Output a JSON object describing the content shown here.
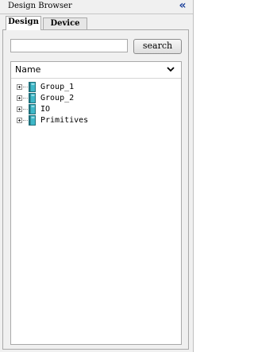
{
  "window": {
    "title": "Design Browser",
    "collapse_icon": "double-chevron-left-icon"
  },
  "tabs": [
    {
      "label": "Design",
      "active": true
    },
    {
      "label": "Device",
      "active": false
    }
  ],
  "search": {
    "value": "",
    "placeholder": "",
    "button_label": "search"
  },
  "tree": {
    "column_header": "Name",
    "header_icon": "chevron-down-icon",
    "items": [
      {
        "label": "Group_1",
        "expanded": false,
        "icon": "book-icon"
      },
      {
        "label": "Group_2",
        "expanded": false,
        "icon": "book-icon"
      },
      {
        "label": "IO",
        "expanded": false,
        "icon": "book-icon"
      },
      {
        "label": "Primitives",
        "expanded": false,
        "icon": "book-icon"
      }
    ]
  },
  "colors": {
    "accent": "#1a3f9a",
    "book_fill": "#3fb8c8",
    "book_dark": "#1f6f7a"
  }
}
